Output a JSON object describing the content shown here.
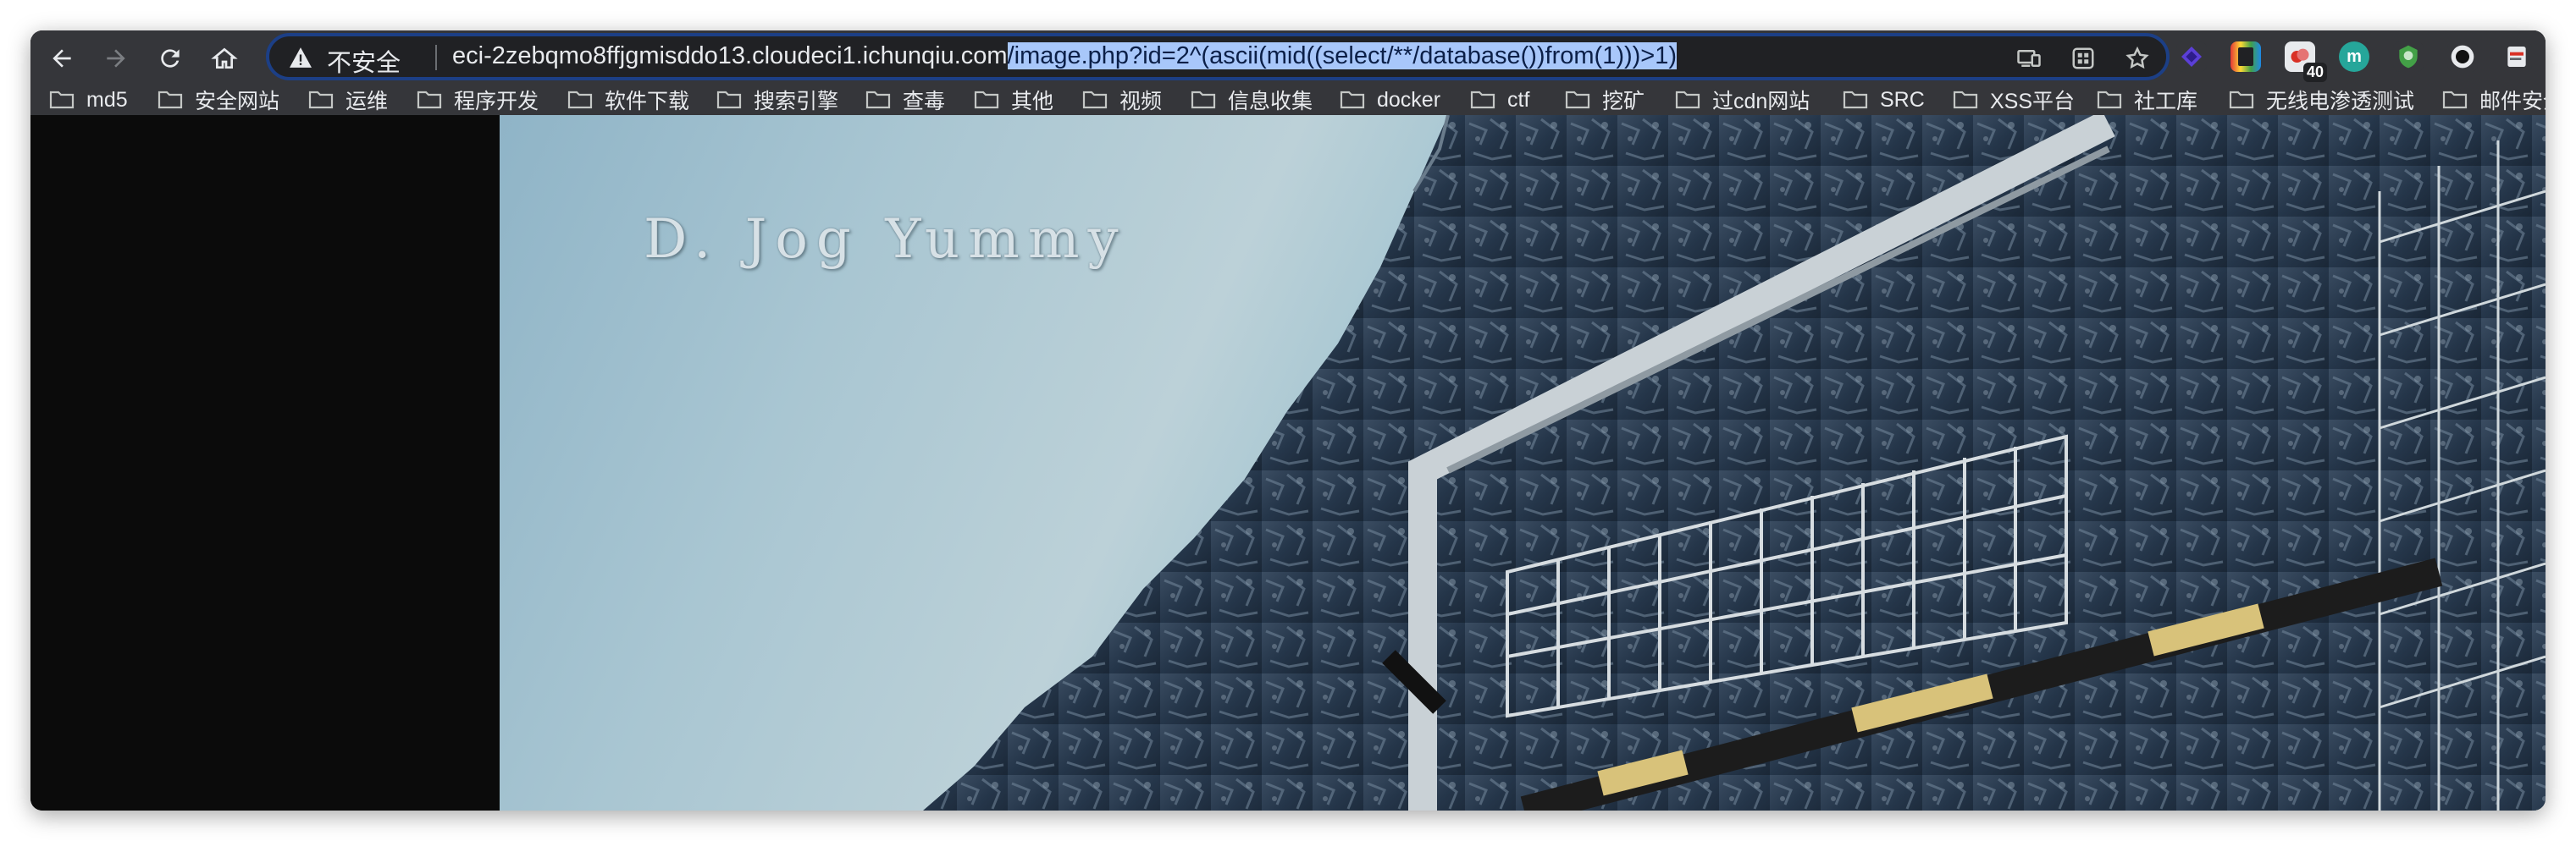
{
  "browser": {
    "security_label": "不安全",
    "url_host": "eci-2zebqmo8ffjgmisddo13.cloudeci1.ichunqiu.com",
    "url_path_selected": "/image.php?id=2^(ascii(mid((select/**/database())from(1)))>1)",
    "extensions": {
      "badge_count": "40",
      "teal_ext_letter": "m"
    }
  },
  "bookmarks": [
    {
      "label": "md5"
    },
    {
      "label": "安全网站"
    },
    {
      "label": "运维"
    },
    {
      "label": "程序开发"
    },
    {
      "label": "软件下载"
    },
    {
      "label": "搜索引擎"
    },
    {
      "label": "查毒"
    },
    {
      "label": "其他"
    },
    {
      "label": "视频"
    },
    {
      "label": "信息收集"
    },
    {
      "label": "docker"
    },
    {
      "label": "ctf"
    },
    {
      "label": "挖矿"
    },
    {
      "label": "过cdn网站"
    },
    {
      "label": "SRC"
    },
    {
      "label": "XSS平台"
    },
    {
      "label": "社工库"
    },
    {
      "label": "无线电渗透测试"
    },
    {
      "label": "邮件安全"
    }
  ],
  "page": {
    "caption": "D. Jog Yummy"
  },
  "colors": {
    "toolbar_bg": "#35363a",
    "omnibox_bg": "#202124",
    "omnibox_focus": "#1c3f86",
    "selection": "#a8c7fa",
    "text": "#e8eaed"
  }
}
